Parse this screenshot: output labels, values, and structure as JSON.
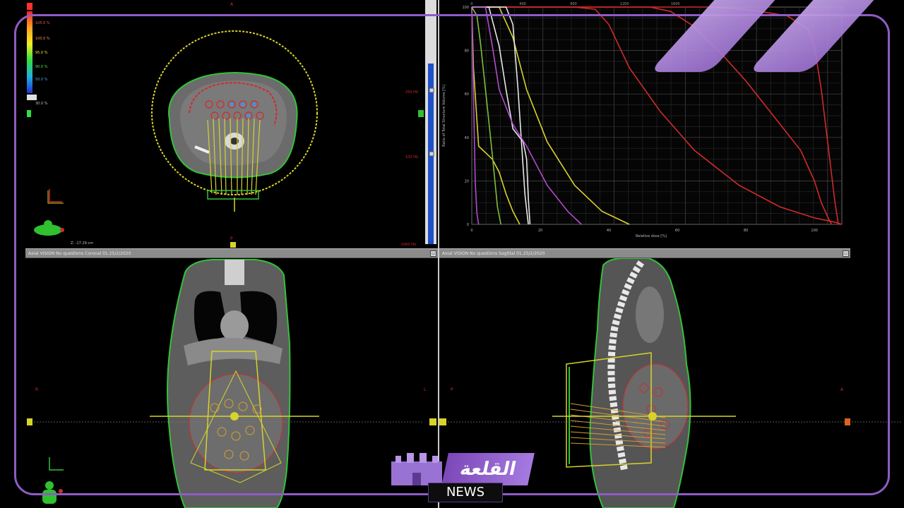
{
  "colors": {
    "accent": "#8e5cc4",
    "dose_red": "#d12a2a",
    "dose_yellow": "#d8d32a",
    "body_green": "#33c23a"
  },
  "axial_view": {
    "dose_legend": [
      "105.0 %",
      "100.0 %",
      "95.0 %",
      "90.0 %",
      "50.0 %",
      "30.0 %"
    ],
    "scale_labels": [
      "250 HU",
      "100 HU",
      "-1000 HU"
    ],
    "marker_top": "A",
    "marker_bottom": "P",
    "slice_label": "Z: -17.29 cm"
  },
  "dvh_view": {
    "y_ticks": [
      "100",
      "80",
      "60",
      "40",
      "20",
      "0"
    ],
    "x_ticks": [
      "0",
      "20",
      "40",
      "60",
      "80",
      "100"
    ],
    "top_ticks": [
      "0",
      "400",
      "800",
      "1200",
      "1600"
    ],
    "xlabel": "Relative dose [%]",
    "ylabel": "Ratio of Total Structure Volume [%]"
  },
  "chart_data": {
    "type": "line",
    "xlabel": "Relative dose [%]",
    "ylabel": "Ratio of Total Structure Volume [%]",
    "xlim": [
      0,
      108
    ],
    "ylim": [
      0,
      100
    ],
    "grid": true,
    "series": [
      {
        "color": "#d12a2a",
        "x": [
          0,
          30,
          36,
          40,
          46,
          55,
          65,
          78,
          90,
          100,
          106,
          108
        ],
        "y": [
          100,
          100,
          99,
          92,
          72,
          52,
          34,
          18,
          8,
          3,
          1,
          0
        ]
      },
      {
        "color": "#d12a2a",
        "x": [
          0,
          52,
          58,
          64,
          72,
          80,
          88,
          96,
          100,
          102,
          104,
          105
        ],
        "y": [
          100,
          100,
          98,
          92,
          80,
          66,
          50,
          34,
          20,
          10,
          3,
          0
        ]
      },
      {
        "color": "#d12a2a",
        "x": [
          0,
          70,
          80,
          92,
          98,
          100,
          102,
          104,
          106,
          107
        ],
        "y": [
          100,
          100,
          99,
          96,
          90,
          82,
          62,
          36,
          10,
          0
        ]
      },
      {
        "color": "#d8d32a",
        "x": [
          0,
          8,
          12,
          16,
          22,
          30,
          38,
          46
        ],
        "y": [
          100,
          100,
          86,
          62,
          38,
          18,
          6,
          0
        ]
      },
      {
        "color": "#d8d32a",
        "x": [
          0,
          0.5,
          2,
          6,
          8,
          10,
          12,
          14
        ],
        "y": [
          100,
          72,
          36,
          30,
          24,
          14,
          6,
          0
        ]
      },
      {
        "color": "#e8e8e8",
        "x": [
          0,
          5,
          8,
          10,
          12,
          15,
          16,
          16.5,
          17
        ],
        "y": [
          100,
          100,
          82,
          62,
          44,
          38,
          30,
          12,
          0
        ]
      },
      {
        "color": "#e8e8e8",
        "x": [
          0,
          10,
          12,
          13.5,
          14.5,
          15.5,
          16.5
        ],
        "y": [
          100,
          100,
          92,
          62,
          38,
          14,
          0
        ]
      },
      {
        "color": "#b24ccf",
        "x": [
          0,
          4,
          6,
          8,
          12,
          16,
          22,
          28,
          32
        ],
        "y": [
          100,
          100,
          82,
          62,
          46,
          36,
          18,
          6,
          0
        ]
      },
      {
        "color": "#b24ccf",
        "x": [
          0,
          0.5,
          1,
          1.5,
          2
        ],
        "y": [
          100,
          60,
          20,
          5,
          0
        ]
      },
      {
        "color": "#7fbf3a",
        "x": [
          0,
          1.5,
          2.5,
          4,
          6,
          7.5,
          8.5
        ],
        "y": [
          100,
          96,
          84,
          62,
          32,
          8,
          0
        ]
      }
    ]
  },
  "coronal_view": {
    "marker_left": "R",
    "marker_right": "L",
    "titlebar": "Axial VISION    No questions    Coronal    01.25/2/2020"
  },
  "sagittal_view": {
    "marker_left": "P",
    "marker_right": "A",
    "titlebar": "Axial VISION    No questions    Sagittal    01.25/2/2020"
  },
  "watermark": {
    "arabic": "القلعة",
    "latin": "NEWS"
  }
}
